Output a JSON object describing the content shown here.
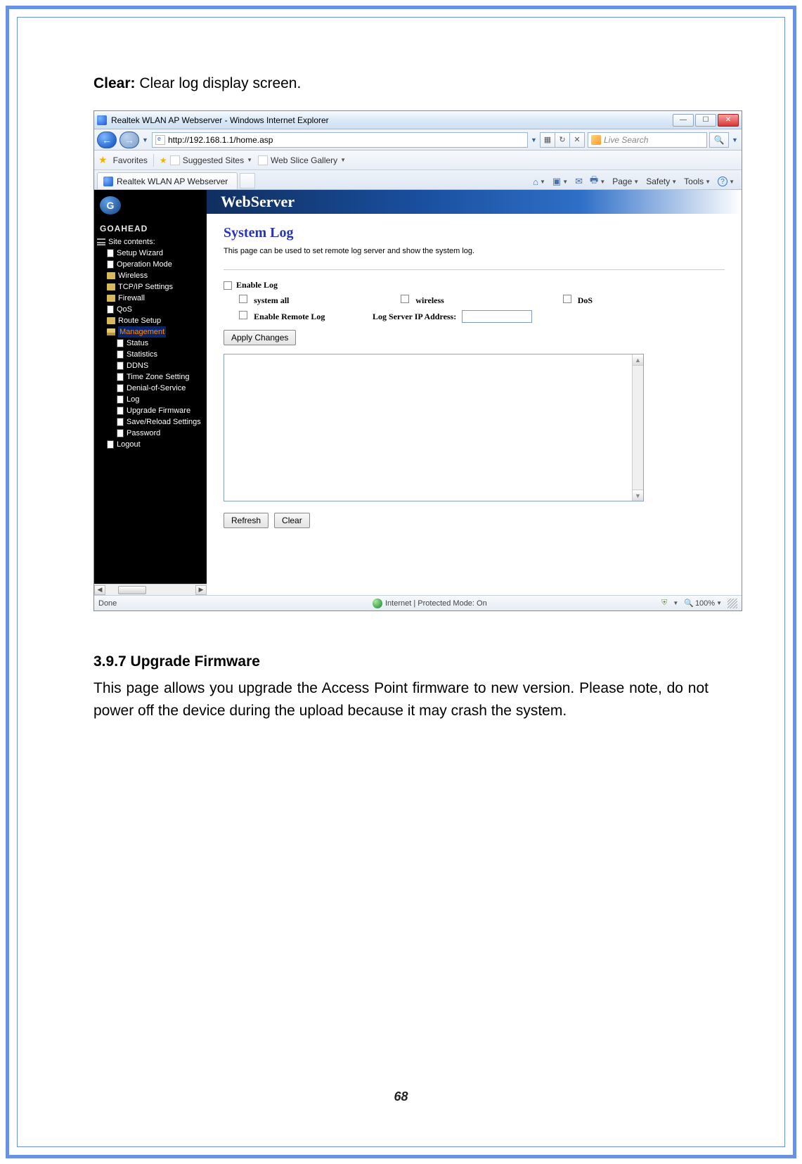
{
  "doc": {
    "clear_label": "Clear:",
    "clear_desc": " Clear log display screen.",
    "section_h": "3.9.7  Upgrade Firmware",
    "section_p": "This page allows you upgrade the Access Point firmware to new version. Please note, do not power off the device during the upload because it may crash the system.",
    "page_num": "68"
  },
  "win": {
    "title": "Realtek WLAN AP Webserver - Windows Internet Explorer",
    "min": "—",
    "max": "☐",
    "close": "✕"
  },
  "addr": {
    "url": "http://192.168.1.1/home.asp",
    "search_placeholder": "Live Search",
    "refresh": "↻",
    "stop": "✕",
    "mag": "🔍"
  },
  "fav": {
    "label": "Favorites",
    "suggested": "Suggested Sites",
    "gallery": "Web Slice Gallery"
  },
  "tab": {
    "title": "Realtek WLAN AP Webserver"
  },
  "cmd": {
    "home": "⌂",
    "feeds": "▣",
    "mail": "✉",
    "print": "🖶",
    "page": "Page",
    "safety": "Safety",
    "tools": "Tools",
    "help": "?"
  },
  "sidebar": {
    "brand": "GOAHEAD",
    "site_contents": "Site contents:",
    "items": {
      "setup_wizard": "Setup Wizard",
      "op_mode": "Operation Mode",
      "wireless": "Wireless",
      "tcpip": "TCP/IP Settings",
      "firewall": "Firewall",
      "qos": "QoS",
      "route": "Route Setup",
      "management": "Management",
      "status": "Status",
      "statistics": "Statistics",
      "ddns": "DDNS",
      "tz": "Time Zone Setting",
      "dos": "Denial-of-Service",
      "log": "Log",
      "upgrade": "Upgrade Firmware",
      "save": "Save/Reload Settings",
      "password": "Password",
      "logout": "Logout"
    }
  },
  "panel": {
    "banner": "WebServer",
    "h": "System Log",
    "desc": "This page can be used to set remote log server and show the system log.",
    "enable_log": "Enable Log",
    "system_all": "system all",
    "wireless": "wireless",
    "dos": "DoS",
    "enable_remote": "Enable Remote Log",
    "ip_label": "Log Server IP Address:",
    "apply": "Apply Changes",
    "refresh": "Refresh",
    "clear": "Clear"
  },
  "status": {
    "done": "Done",
    "mode": "Internet | Protected Mode: On",
    "zoom": "100%"
  }
}
